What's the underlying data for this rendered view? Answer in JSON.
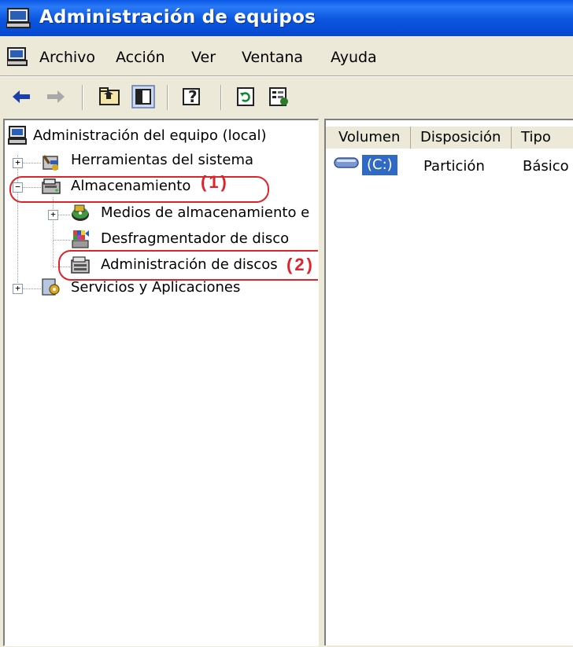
{
  "window": {
    "title": "Administración de equipos"
  },
  "menu": {
    "items": [
      "Archivo",
      "Acción",
      "Ver",
      "Ventana",
      "Ayuda"
    ]
  },
  "toolbar": {
    "buttons": [
      "back-arrow-icon",
      "forward-arrow-icon",
      "up-folder-icon",
      "show-hide-tree-icon",
      "help-icon",
      "refresh-icon",
      "properties-icon"
    ]
  },
  "tree": {
    "root": "Administración del equipo (local)",
    "items": [
      {
        "label": "Herramientas del sistema",
        "expander": "+"
      },
      {
        "label": "Almacenamiento",
        "expander": "−"
      },
      {
        "label": "Medios de almacenamiento e",
        "expander": "+"
      },
      {
        "label": "Desfragmentador de disco"
      },
      {
        "label": "Administración de discos"
      },
      {
        "label": "Servicios y Aplicaciones",
        "expander": "+"
      }
    ]
  },
  "annotations": {
    "one": "(1)",
    "two": "(2)"
  },
  "list": {
    "columns": [
      "Volumen",
      "Disposición",
      "Tipo"
    ],
    "rows": [
      {
        "volume": "(C:)",
        "layout": "Partición",
        "type": "Básico"
      }
    ]
  },
  "colors": {
    "title_bar": "#0a58e6",
    "selection": "#316ac5",
    "annotation": "#e0232a",
    "window_bg": "#ece9d8"
  }
}
